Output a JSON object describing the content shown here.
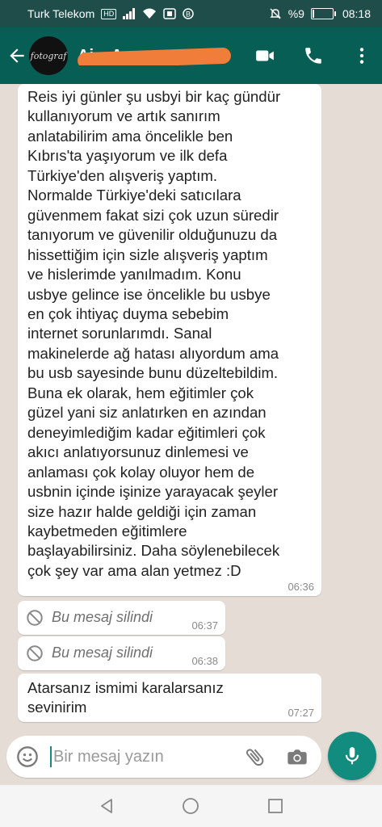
{
  "status_bar": {
    "carrier": "Turk Telekom",
    "network_badge": "HD",
    "battery_text": "%9",
    "battery_level_percent": 9,
    "time": "08:18"
  },
  "header": {
    "contact_name": "Ai... Ar...",
    "avatar_logo_text": "fotograf"
  },
  "messages": [
    {
      "text": "Reis iyi günler şu usbyi bir kaç gündür\nkullanıyorum ve artık sanırım\nanlatabilirim ama öncelikle ben\nKıbrıs'ta yaşıyorum ve ilk defa\nTürkiye'den alışveriş yaptım.\nNormalde Türkiye'deki satıcılara\ngüvenmem fakat sizi çok uzun süredir\ntanıyorum ve güvenilir olduğunuzu da\nhissettiğim için sizle alışveriş yaptım\nve hislerimde yanılmadım. Konu\nusbye gelince ise öncelikle bu usbye\nen çok ihtiyaç duyma sebebim\ninternet sorunlarımdı. Sanal\nmakinelerde ağ hatası alıyordum ama\nbu usb sayesinde bunu düzeltebildim.\nBuna ek olarak,  hem eğitimler çok\ngüzel yani siz anlatırken en azından\ndeneyimlediğim kadar eğitimleri çok\nakıcı anlatıyorsunuz dinlemesi ve\nanlaması çok kolay oluyor hem de\nusbnin içinde işinize yarayacak şeyler\nsize hazır halde geldiği için zaman\nkaybetmeden eğitimlere\nbaşlayabilirsiniz. Daha söylenebilecek\nçok şey var ama alan yetmez :D",
      "time": "06:36"
    },
    {
      "text": "Bu mesaj silindi",
      "time": "06:37"
    },
    {
      "text": "Bu mesaj silindi",
      "time": "06:38"
    },
    {
      "text": "Atarsanız ismimi karalarsanız\nsevinirim",
      "time": "07:27"
    }
  ],
  "composer": {
    "placeholder": "Bir mesaj yazın"
  },
  "colors": {
    "header": "#075e54",
    "status_bar": "#1f4e4a",
    "accent": "#128c7e",
    "chat_background": "#e5ddd5",
    "redaction": "#f07d3a"
  },
  "icons": [
    "back-arrow-icon",
    "video-call-icon",
    "phone-icon",
    "more-options-icon",
    "deleted-icon",
    "emoji-icon",
    "attach-icon",
    "camera-icon",
    "mic-icon",
    "nav-back-icon",
    "nav-home-icon",
    "nav-recents-icon"
  ]
}
